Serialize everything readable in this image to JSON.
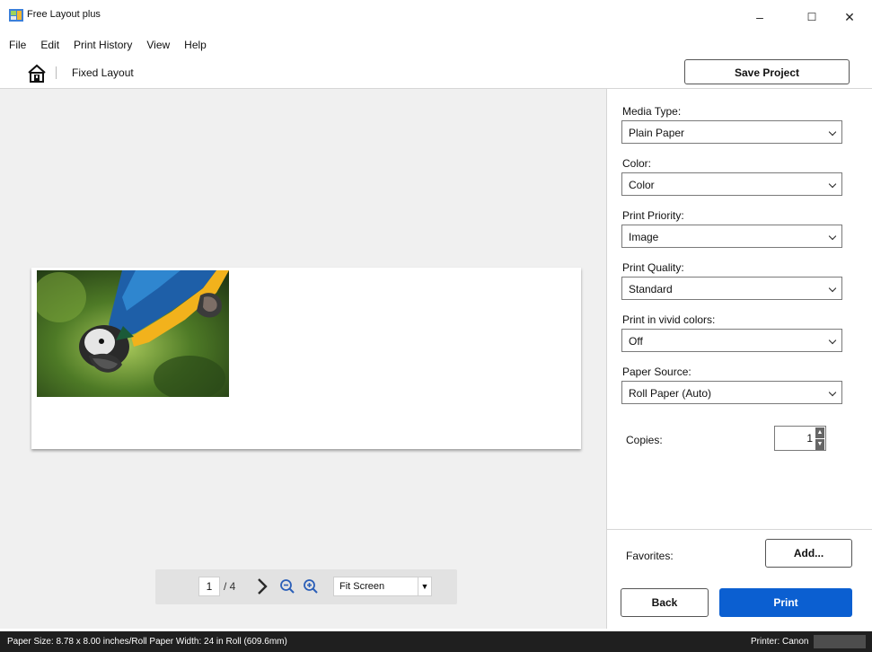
{
  "window": {
    "title": "Free Layout plus",
    "minimize": "–",
    "maximize": "☐",
    "close": "✕"
  },
  "menu": [
    "File",
    "Edit",
    "Print History",
    "View",
    "Help"
  ],
  "toolbar": {
    "breadcrumb": "Fixed Layout",
    "save_label": "Save Project"
  },
  "pager": {
    "current_page": "1",
    "total": "/ 4",
    "zoom_value": "Fit Screen"
  },
  "settings": {
    "media_type": {
      "label": "Media Type:",
      "value": "Plain Paper"
    },
    "color": {
      "label": "Color:",
      "value": "Color"
    },
    "print_priority": {
      "label": "Print Priority:",
      "value": "Image"
    },
    "print_quality": {
      "label": "Print Quality:",
      "value": "Standard"
    },
    "vivid": {
      "label": "Print in vivid colors:",
      "value": "Off"
    },
    "paper_source": {
      "label": "Paper Source:",
      "value": "Roll Paper (Auto)"
    },
    "copies": {
      "label": "Copies:",
      "value": "1"
    }
  },
  "favorites": {
    "label": "Favorites:",
    "add_label": "Add..."
  },
  "actions": {
    "back_label": "Back",
    "print_label": "Print"
  },
  "status": {
    "left": "Paper Size: 8.78 x 8.00 inches/Roll Paper Width: 24 in Roll (609.6mm)",
    "right": "Printer: Canon"
  },
  "colors": {
    "accent": "#0b5fd1",
    "statusbar": "#1f1f1f",
    "preview_bg": "#f0f0f0"
  }
}
